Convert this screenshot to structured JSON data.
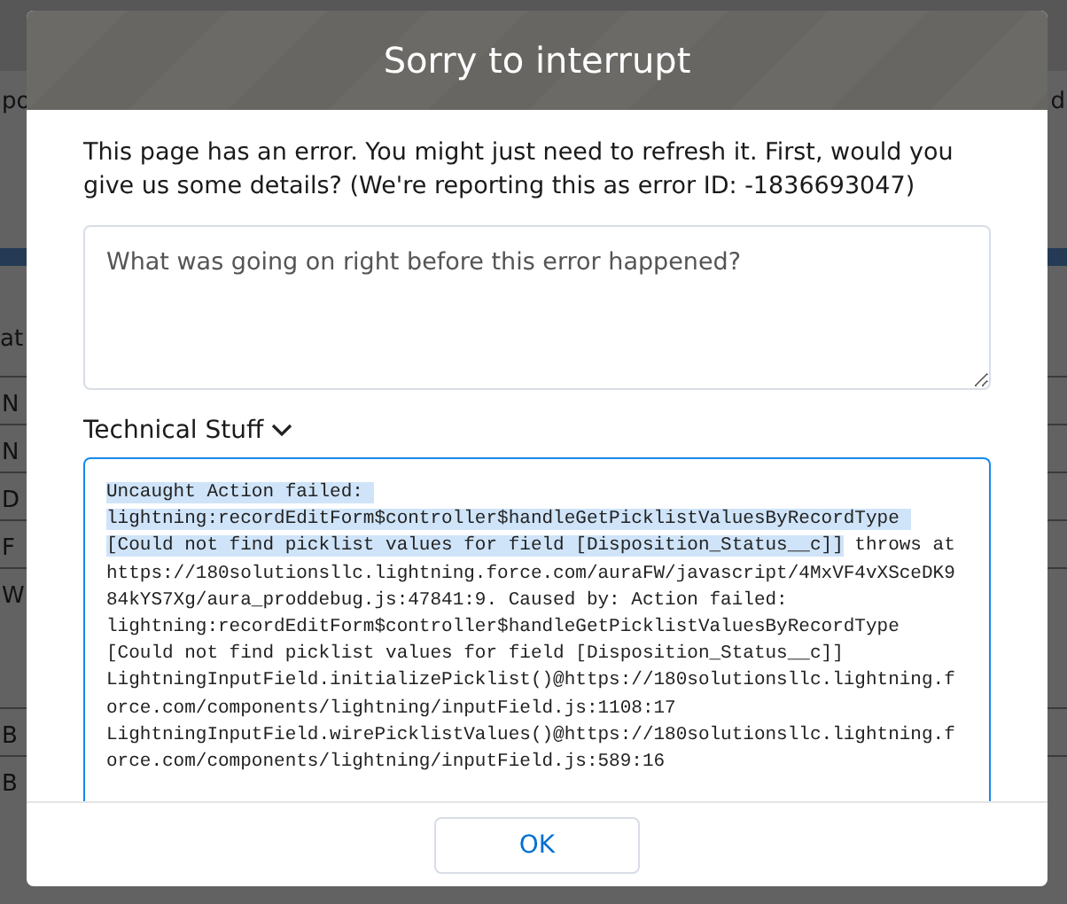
{
  "backdrop": {
    "top_left": "po",
    "top_right": "d",
    "heading": "at",
    "rows": [
      "N",
      "N",
      "D",
      "F",
      "W"
    ],
    "bottom_rows": [
      "B",
      "B"
    ]
  },
  "modal": {
    "title": "Sorry to interrupt",
    "message": "This page has an error. You might just need to refresh it. First, would you give us some details? (We're reporting this as error ID: -1836693047)",
    "feedback": {
      "placeholder": "What was going on right before this error happened?"
    },
    "technical": {
      "label": "Technical Stuff",
      "expanded": true,
      "highlighted_text": "Uncaught Action failed: lightning:recordEditForm$controller$handleGetPicklistValuesByRecordType [Could not find picklist values for field [Disposition_Status__c]]",
      "text": " throws at https://180solutionsllc.lightning.force.com/auraFW/javascript/4MxVF4vXSceDK984kYS7Xg/aura_proddebug.js:47841:9. Caused by: Action failed: lightning:recordEditForm$controller$handleGetPicklistValuesByRecordType [Could not find picklist values for field [Disposition_Status__c]] LightningInputField.initializePicklist()@https://180solutionsllc.lightning.force.com/components/lightning/inputField.js:1108:17 LightningInputField.wirePicklistValues()@https://180solutionsllc.lightning.force.com/components/lightning/inputField.js:589:16"
    },
    "buttons": [
      {
        "label": "OK"
      }
    ]
  }
}
